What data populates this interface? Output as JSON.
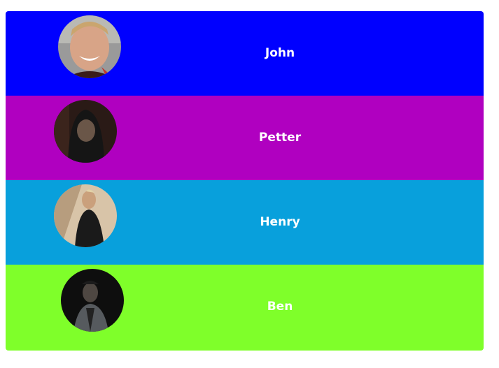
{
  "people": [
    {
      "name": "John",
      "color": "#0000ff",
      "avatar": "smiling-man-photo"
    },
    {
      "name": "Petter",
      "color": "#b000c0",
      "avatar": "hooded-man-photo"
    },
    {
      "name": "Henry",
      "color": "#08a0dc",
      "avatar": "man-in-leather-jacket-photo"
    },
    {
      "name": "Ben",
      "color": "#7fff2a",
      "avatar": "man-in-dark-photo"
    }
  ]
}
